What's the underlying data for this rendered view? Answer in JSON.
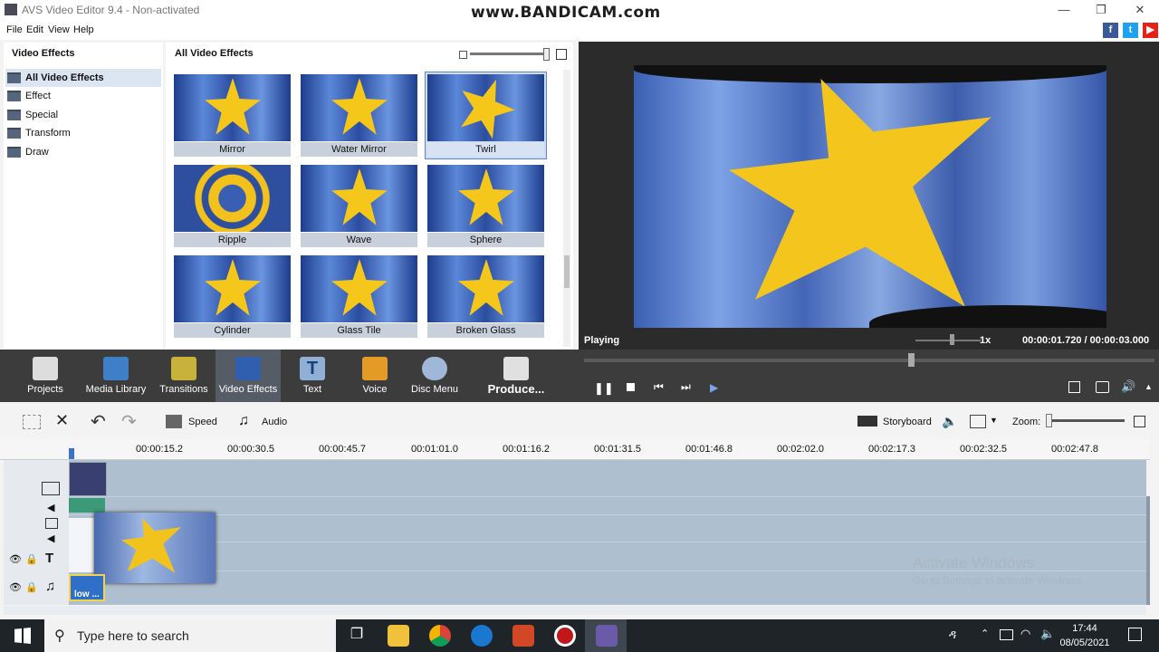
{
  "window": {
    "title": "AVS Video Editor 9.4 - Non-activated",
    "overlay": "www.BANDICAM.com"
  },
  "menu": [
    "File",
    "Edit",
    "View",
    "Help"
  ],
  "social": [
    "f",
    "t",
    "▶"
  ],
  "left_panel": {
    "header": "Video Effects",
    "items": [
      {
        "label": "All Video Effects",
        "selected": true
      },
      {
        "label": "Effect"
      },
      {
        "label": "Special"
      },
      {
        "label": "Transform"
      },
      {
        "label": "Draw"
      }
    ]
  },
  "effects_panel": {
    "header": "All Video Effects",
    "items": [
      {
        "label": "Mirror"
      },
      {
        "label": "Water Mirror"
      },
      {
        "label": "Twirl",
        "selected": true
      },
      {
        "label": "Ripple"
      },
      {
        "label": "Wave"
      },
      {
        "label": "Sphere"
      },
      {
        "label": "Cylinder"
      },
      {
        "label": "Glass Tile"
      },
      {
        "label": "Broken Glass"
      }
    ]
  },
  "preview": {
    "status": "Playing",
    "speed": "1x",
    "current_time": "00:00:01.720",
    "separator": "/",
    "total_time": "00:00:03.000"
  },
  "toolbar": {
    "items": [
      {
        "label": "Projects",
        "icon": "clapperboard-icon"
      },
      {
        "label": "Media Library",
        "icon": "film-icon"
      },
      {
        "label": "Transitions",
        "icon": "transitions-icon"
      },
      {
        "label": "Video Effects",
        "icon": "star-icon",
        "selected": true
      },
      {
        "label": "Text",
        "icon": "text-icon"
      },
      {
        "label": "Voice",
        "icon": "microphone-icon"
      },
      {
        "label": "Disc Menu",
        "icon": "disc-icon"
      },
      {
        "label": "Produce...",
        "icon": "produce-icon"
      }
    ]
  },
  "timeline_toolbar": {
    "speed": "Speed",
    "audio": "Audio",
    "storyboard": "Storyboard",
    "zoom": "Zoom:"
  },
  "ruler": [
    "00:00:15.2",
    "00:00:30.5",
    "00:00:45.7",
    "00:01:01.0",
    "00:01:16.2",
    "00:01:31.5",
    "00:01:46.8",
    "00:02:02.0",
    "00:02:17.3",
    "00:02:32.5",
    "00:02:47.8"
  ],
  "timeline": {
    "audio_clip_label": "low ..."
  },
  "watermark": {
    "line1": "Activate Windows",
    "line2": "Go to Settings to activate Windows."
  },
  "taskbar": {
    "search_placeholder": "Type here to search",
    "time": "17:44",
    "date": "08/05/2021"
  }
}
